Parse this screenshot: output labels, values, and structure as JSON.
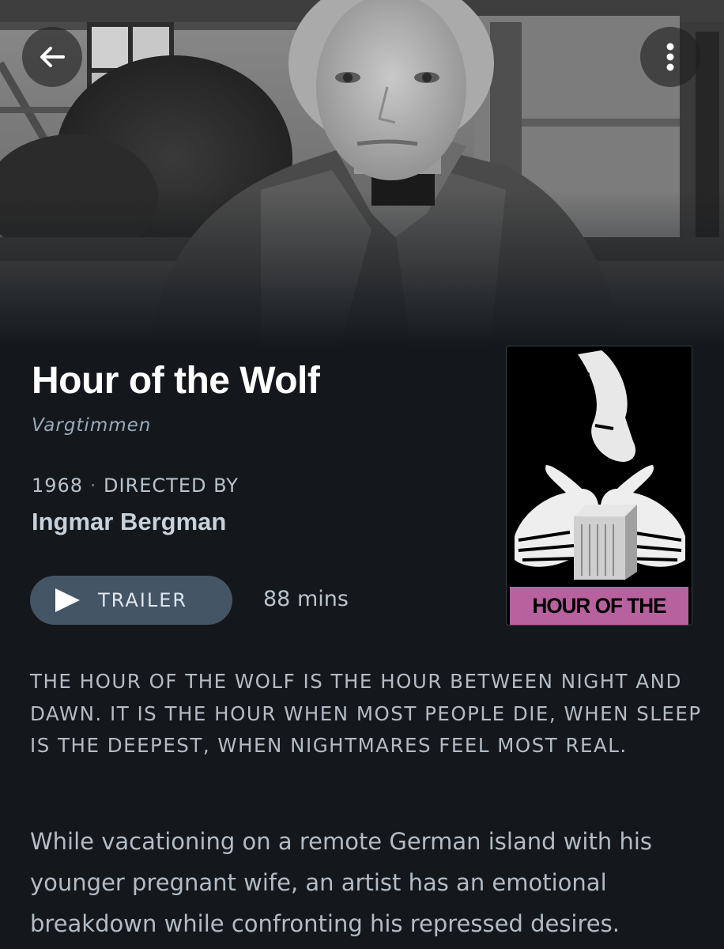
{
  "header": {
    "back_icon": "arrow-left-icon",
    "menu_icon": "more-vertical-icon"
  },
  "film": {
    "title": "Hour of the Wolf",
    "original_title": "Vargtimmen",
    "year": "1968",
    "separator": "·",
    "directed_by_label": "DIRECTED BY",
    "director": "Ingmar Bergman",
    "runtime": "88 mins",
    "tagline": "THE HOUR OF THE WOLF IS THE HOUR BETWEEN NIGHT AND DAWN. IT IS THE HOUR WHEN MOST PEOPLE DIE, WHEN SLEEP IS THE DEEPEST, WHEN NIGHTMARES FEEL MOST REAL.",
    "synopsis": "While vacationing on a remote German island with his younger pregnant wife, an artist has an emotional breakdown while confronting his repressed desires."
  },
  "poster": {
    "title_text": "HOUR OF THE WOLF",
    "band_color": "#b8619f"
  },
  "actions": {
    "trailer_label": "TRAILER",
    "play_icon": "play-icon"
  },
  "colors": {
    "background": "#14181c",
    "button_bg": "#445566",
    "muted_text": "#99aabb"
  }
}
